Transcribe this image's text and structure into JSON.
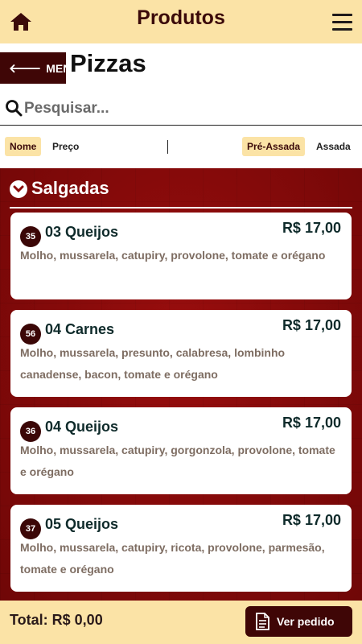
{
  "header": {
    "title": "Produtos"
  },
  "nav": {
    "menu_label": "MENU",
    "page_title": "Pizzas"
  },
  "search": {
    "placeholder": "Pesquisar..."
  },
  "filters": {
    "sort": [
      {
        "label": "Nome",
        "active": true
      },
      {
        "label": "Preço",
        "active": false
      }
    ],
    "type": [
      {
        "label": "Pré-Assada",
        "active": true
      },
      {
        "label": "Assada",
        "active": false
      }
    ]
  },
  "section": {
    "title": "Salgadas"
  },
  "products": [
    {
      "code": "35",
      "name": "03 Queijos",
      "price": "R$ 17,00",
      "desc": "Molho, mussarela, catupiry, provolone, tomate e orégano"
    },
    {
      "code": "56",
      "name": "04 Carnes",
      "price": "R$ 17,00",
      "desc": "Molho, mussarela, presunto, calabresa, lombinho canadense, bacon, tomate e orégano"
    },
    {
      "code": "36",
      "name": "04 Queijos",
      "price": "R$ 17,00",
      "desc": "Molho, mussarela, catupiry, gorgonzola, provolone, tomate e orégano"
    },
    {
      "code": "37",
      "name": "05 Queijos",
      "price": "R$ 17,00",
      "desc": "Molho, mussarela, catupiry, ricota, provolone, parmesão, tomate e orégano"
    }
  ],
  "footer": {
    "total": "Total: R$ 0,00",
    "ver_pedido": "Ver pedido"
  },
  "colors": {
    "accent": "#fbe3a6",
    "brand_dark": "#3f0606",
    "background_red": "#8b0a0a"
  }
}
